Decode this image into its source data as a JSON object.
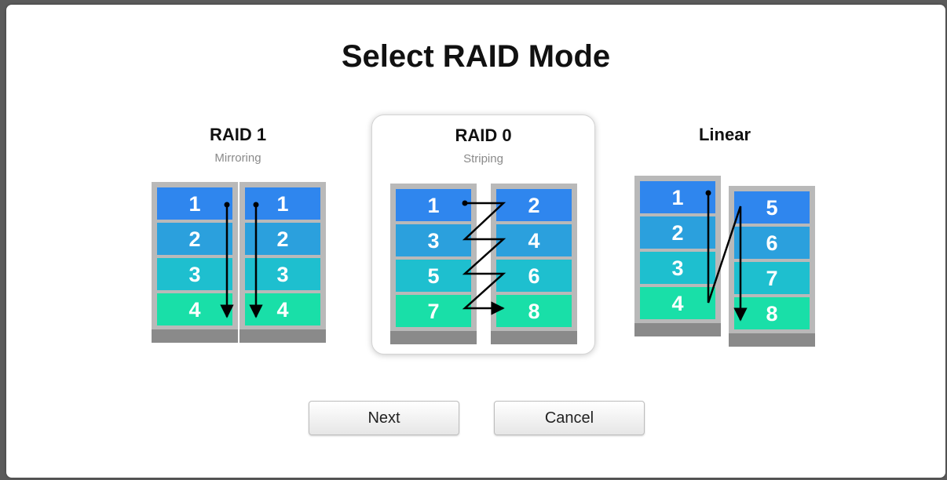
{
  "dialog": {
    "title": "Select RAID Mode",
    "options": [
      {
        "name": "RAID 1",
        "subtitle": "Mirroring",
        "selected": false
      },
      {
        "name": "RAID 0",
        "subtitle": "Striping",
        "selected": true
      },
      {
        "name": "Linear",
        "subtitle": "",
        "selected": false
      }
    ],
    "buttons": {
      "next": "Next",
      "cancel": "Cancel"
    }
  },
  "diagrams": {
    "raid1": {
      "disk_a": [
        "1",
        "2",
        "3",
        "4"
      ],
      "disk_b": [
        "1",
        "2",
        "3",
        "4"
      ]
    },
    "raid0": {
      "disk_a": [
        "1",
        "3",
        "5",
        "7"
      ],
      "disk_b": [
        "2",
        "4",
        "6",
        "8"
      ]
    },
    "linear": {
      "disk_a": [
        "1",
        "2",
        "3",
        "4"
      ],
      "disk_b": [
        "5",
        "6",
        "7",
        "8"
      ]
    }
  },
  "colors": {
    "block_1": "#2f86ee",
    "block_2": "#2ba0dd",
    "block_3": "#1ebfcf",
    "block_4": "#19dfa8",
    "disk_frame": "#b9b9b9",
    "disk_base": "#8a8a8a",
    "arrow": "#000000"
  }
}
